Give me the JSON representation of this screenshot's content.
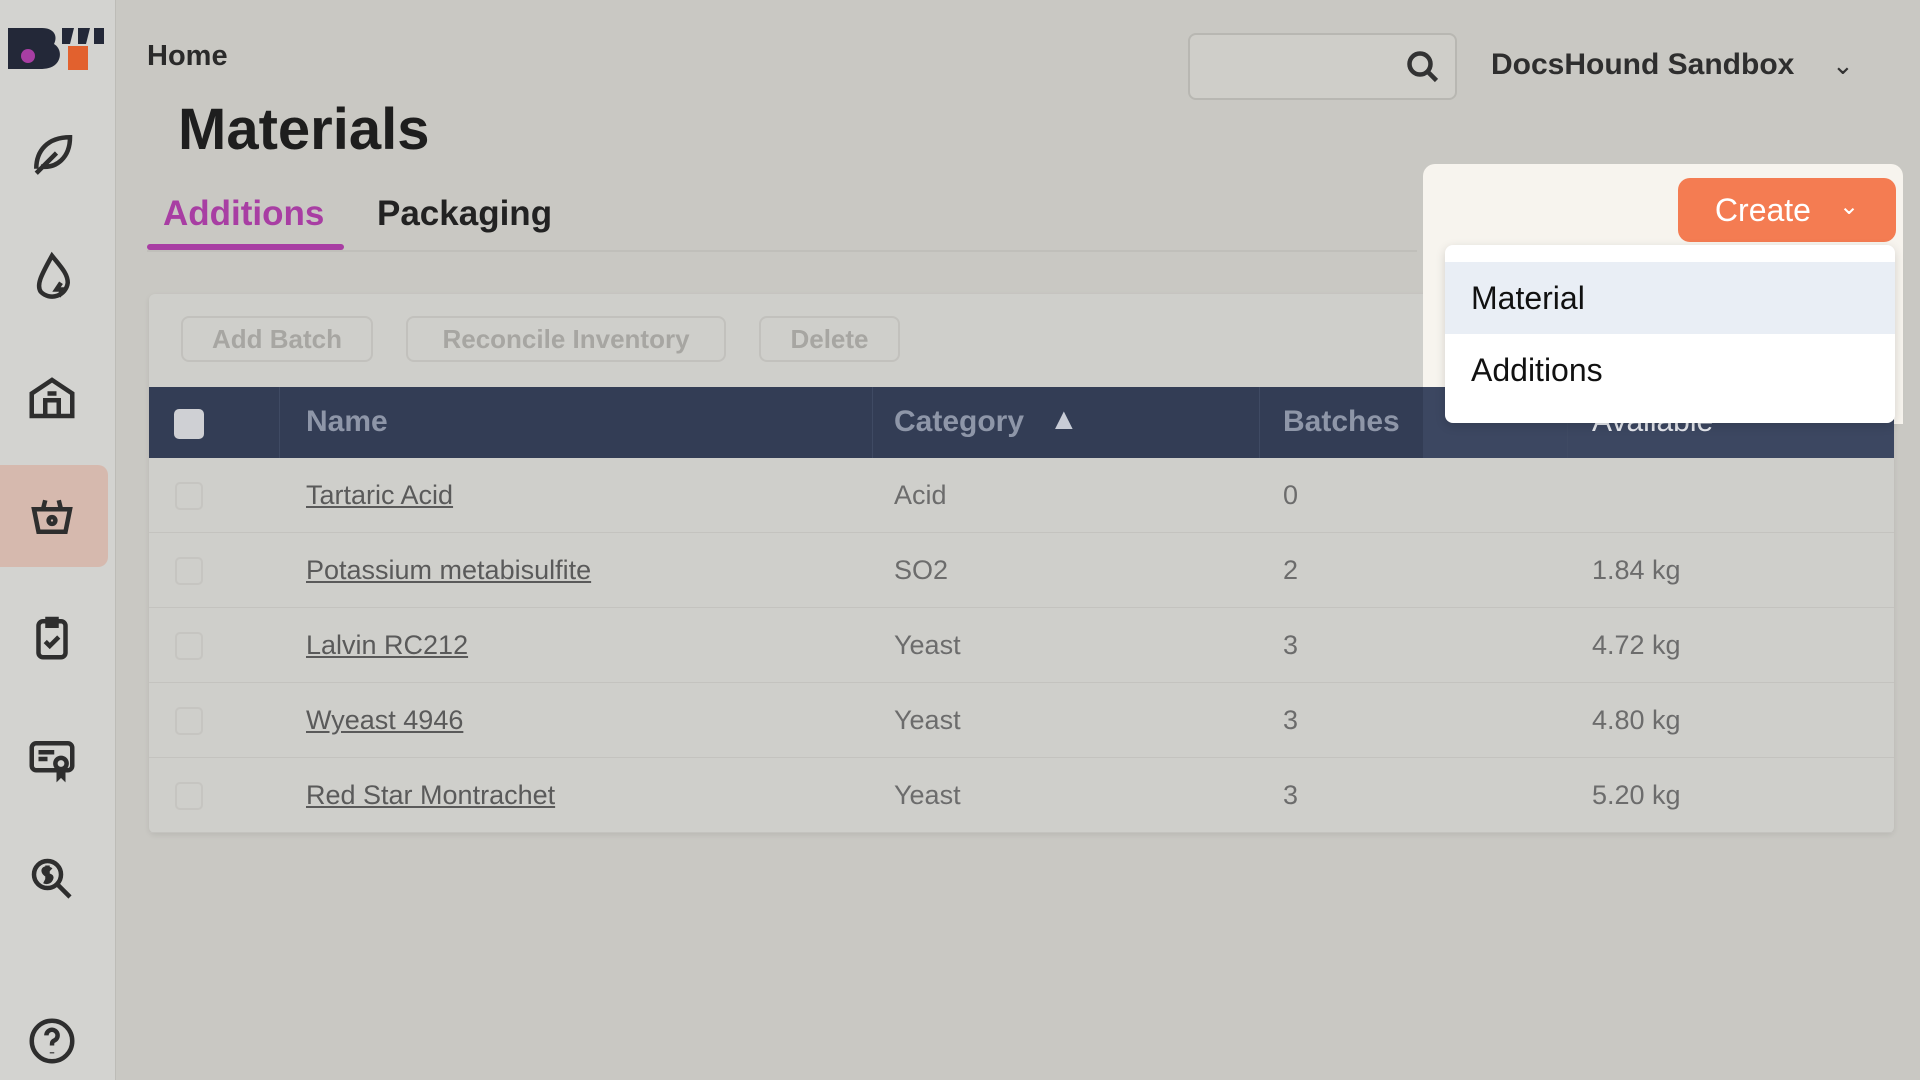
{
  "breadcrumb": {
    "home": "Home"
  },
  "page_title": "Materials",
  "tabs": [
    {
      "label": "Additions",
      "active": true
    },
    {
      "label": "Packaging",
      "active": false
    }
  ],
  "header": {
    "search_placeholder": "",
    "org_name": "DocsHound Sandbox"
  },
  "sidebar": {
    "items": [
      {
        "icon": "leaf-icon"
      },
      {
        "icon": "drop-icon"
      },
      {
        "icon": "building-icon"
      },
      {
        "icon": "basket-icon",
        "active": true
      },
      {
        "icon": "clipboard-check-icon"
      },
      {
        "icon": "certificate-icon"
      },
      {
        "icon": "dollar-search-icon"
      },
      {
        "icon": "help-icon"
      }
    ]
  },
  "toolbar": {
    "add_batch": "Add Batch",
    "reconcile": "Reconcile Inventory",
    "delete": "Delete"
  },
  "table": {
    "columns": [
      "Name",
      "Category",
      "Batches",
      "Available"
    ],
    "sort": {
      "column": "Category",
      "direction": "asc"
    },
    "rows": [
      {
        "name": "Tartaric Acid",
        "category": "Acid",
        "batches": "0",
        "available": ""
      },
      {
        "name": "Potassium metabisulfite",
        "category": "SO2",
        "batches": "2",
        "available": "1.84 kg"
      },
      {
        "name": "Lalvin RC212",
        "category": "Yeast",
        "batches": "3",
        "available": "4.72 kg"
      },
      {
        "name": "Wyeast 4946",
        "category": "Yeast",
        "batches": "3",
        "available": "4.80 kg"
      },
      {
        "name": "Red Star Montrachet",
        "category": "Yeast",
        "batches": "3",
        "available": "5.20 kg"
      }
    ]
  },
  "create_menu": {
    "button": "Create",
    "items": [
      "Material",
      "Additions"
    ],
    "highlighted": "Material"
  },
  "colors": {
    "accent": "#a83ea3",
    "create": "#f47c52",
    "table_header": "#333d55"
  }
}
